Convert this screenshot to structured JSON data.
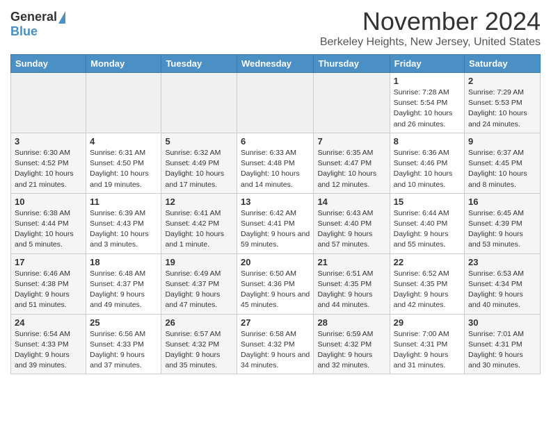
{
  "header": {
    "logo_general": "General",
    "logo_blue": "Blue",
    "month_title": "November 2024",
    "subtitle": "Berkeley Heights, New Jersey, United States"
  },
  "weekdays": [
    "Sunday",
    "Monday",
    "Tuesday",
    "Wednesday",
    "Thursday",
    "Friday",
    "Saturday"
  ],
  "weeks": [
    {
      "days": [
        {
          "num": "",
          "info": ""
        },
        {
          "num": "",
          "info": ""
        },
        {
          "num": "",
          "info": ""
        },
        {
          "num": "",
          "info": ""
        },
        {
          "num": "",
          "info": ""
        },
        {
          "num": "1",
          "info": "Sunrise: 7:28 AM\nSunset: 5:54 PM\nDaylight: 10 hours and 26 minutes."
        },
        {
          "num": "2",
          "info": "Sunrise: 7:29 AM\nSunset: 5:53 PM\nDaylight: 10 hours and 24 minutes."
        }
      ]
    },
    {
      "days": [
        {
          "num": "3",
          "info": "Sunrise: 6:30 AM\nSunset: 4:52 PM\nDaylight: 10 hours and 21 minutes."
        },
        {
          "num": "4",
          "info": "Sunrise: 6:31 AM\nSunset: 4:50 PM\nDaylight: 10 hours and 19 minutes."
        },
        {
          "num": "5",
          "info": "Sunrise: 6:32 AM\nSunset: 4:49 PM\nDaylight: 10 hours and 17 minutes."
        },
        {
          "num": "6",
          "info": "Sunrise: 6:33 AM\nSunset: 4:48 PM\nDaylight: 10 hours and 14 minutes."
        },
        {
          "num": "7",
          "info": "Sunrise: 6:35 AM\nSunset: 4:47 PM\nDaylight: 10 hours and 12 minutes."
        },
        {
          "num": "8",
          "info": "Sunrise: 6:36 AM\nSunset: 4:46 PM\nDaylight: 10 hours and 10 minutes."
        },
        {
          "num": "9",
          "info": "Sunrise: 6:37 AM\nSunset: 4:45 PM\nDaylight: 10 hours and 8 minutes."
        }
      ]
    },
    {
      "days": [
        {
          "num": "10",
          "info": "Sunrise: 6:38 AM\nSunset: 4:44 PM\nDaylight: 10 hours and 5 minutes."
        },
        {
          "num": "11",
          "info": "Sunrise: 6:39 AM\nSunset: 4:43 PM\nDaylight: 10 hours and 3 minutes."
        },
        {
          "num": "12",
          "info": "Sunrise: 6:41 AM\nSunset: 4:42 PM\nDaylight: 10 hours and 1 minute."
        },
        {
          "num": "13",
          "info": "Sunrise: 6:42 AM\nSunset: 4:41 PM\nDaylight: 9 hours and 59 minutes."
        },
        {
          "num": "14",
          "info": "Sunrise: 6:43 AM\nSunset: 4:40 PM\nDaylight: 9 hours and 57 minutes."
        },
        {
          "num": "15",
          "info": "Sunrise: 6:44 AM\nSunset: 4:40 PM\nDaylight: 9 hours and 55 minutes."
        },
        {
          "num": "16",
          "info": "Sunrise: 6:45 AM\nSunset: 4:39 PM\nDaylight: 9 hours and 53 minutes."
        }
      ]
    },
    {
      "days": [
        {
          "num": "17",
          "info": "Sunrise: 6:46 AM\nSunset: 4:38 PM\nDaylight: 9 hours and 51 minutes."
        },
        {
          "num": "18",
          "info": "Sunrise: 6:48 AM\nSunset: 4:37 PM\nDaylight: 9 hours and 49 minutes."
        },
        {
          "num": "19",
          "info": "Sunrise: 6:49 AM\nSunset: 4:37 PM\nDaylight: 9 hours and 47 minutes."
        },
        {
          "num": "20",
          "info": "Sunrise: 6:50 AM\nSunset: 4:36 PM\nDaylight: 9 hours and 45 minutes."
        },
        {
          "num": "21",
          "info": "Sunrise: 6:51 AM\nSunset: 4:35 PM\nDaylight: 9 hours and 44 minutes."
        },
        {
          "num": "22",
          "info": "Sunrise: 6:52 AM\nSunset: 4:35 PM\nDaylight: 9 hours and 42 minutes."
        },
        {
          "num": "23",
          "info": "Sunrise: 6:53 AM\nSunset: 4:34 PM\nDaylight: 9 hours and 40 minutes."
        }
      ]
    },
    {
      "days": [
        {
          "num": "24",
          "info": "Sunrise: 6:54 AM\nSunset: 4:33 PM\nDaylight: 9 hours and 39 minutes."
        },
        {
          "num": "25",
          "info": "Sunrise: 6:56 AM\nSunset: 4:33 PM\nDaylight: 9 hours and 37 minutes."
        },
        {
          "num": "26",
          "info": "Sunrise: 6:57 AM\nSunset: 4:32 PM\nDaylight: 9 hours and 35 minutes."
        },
        {
          "num": "27",
          "info": "Sunrise: 6:58 AM\nSunset: 4:32 PM\nDaylight: 9 hours and 34 minutes."
        },
        {
          "num": "28",
          "info": "Sunrise: 6:59 AM\nSunset: 4:32 PM\nDaylight: 9 hours and 32 minutes."
        },
        {
          "num": "29",
          "info": "Sunrise: 7:00 AM\nSunset: 4:31 PM\nDaylight: 9 hours and 31 minutes."
        },
        {
          "num": "30",
          "info": "Sunrise: 7:01 AM\nSunset: 4:31 PM\nDaylight: 9 hours and 30 minutes."
        }
      ]
    }
  ]
}
